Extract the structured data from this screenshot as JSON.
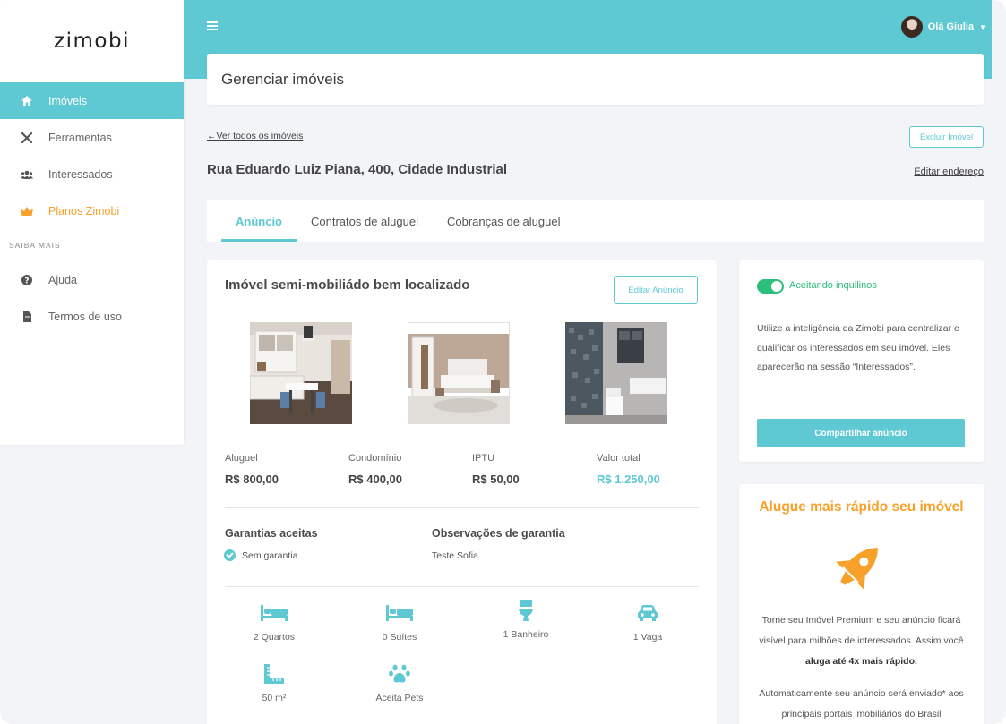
{
  "brand": "zimobi",
  "sidebar": {
    "items": [
      {
        "label": "Imóveis",
        "icon": "home-icon"
      },
      {
        "label": "Ferramentas",
        "icon": "tools-icon"
      },
      {
        "label": "Interessados",
        "icon": "users-icon"
      },
      {
        "label": "Planos Zimobi",
        "icon": "crown-icon"
      }
    ],
    "section_title": "SAIBA MAIS",
    "more_items": [
      {
        "label": "Ajuda",
        "icon": "help-icon"
      },
      {
        "label": "Termos de uso",
        "icon": "document-icon"
      }
    ]
  },
  "header": {
    "user_greeting": "Olá Giulia"
  },
  "page": {
    "title": "Gerenciar imóveis",
    "back_link": "Ver todos os imóveis",
    "delete_button": "Excluir Imóvel",
    "address": "Rua Eduardo Luiz Piana, 400, Cidade Industrial",
    "edit_address": "Editar endereço",
    "tabs": [
      "Anúncio",
      "Contratos de aluguel",
      "Cobranças de aluguel"
    ]
  },
  "listing": {
    "title": "Imóvel semi-mobiliádo bem localizado",
    "edit_button": "Editar Anúncio",
    "prices": [
      {
        "label": "Aluguel",
        "value": "R$ 800,00"
      },
      {
        "label": "Condomínio",
        "value": "R$ 400,00"
      },
      {
        "label": "IPTU",
        "value": "R$ 50,00"
      },
      {
        "label": "Valor total",
        "value": "R$ 1.250,00"
      }
    ],
    "guarantees_title": "Garantias aceitas",
    "guarantee": "Sem garantia",
    "guarantee_notes_title": "Observações de garantia",
    "guarantee_notes": "Teste Sofia",
    "features": [
      {
        "label": "2 Quartos",
        "icon": "bed-icon"
      },
      {
        "label": "0 Suítes",
        "icon": "bed-icon"
      },
      {
        "label": "1 Banheiro",
        "icon": "toilet-icon"
      },
      {
        "label": "1 Vaga",
        "icon": "car-icon"
      },
      {
        "label": "50 m²",
        "icon": "ruler-icon"
      },
      {
        "label": "Aceita Pets",
        "icon": "paw-icon"
      }
    ]
  },
  "share": {
    "toggle_label": "Aceitando inquilinos",
    "text": "Utilize a inteligência da Zimobi para centralizar e qualificar os interessados em seu imóvel. Eles aparecerão na sessão “Interessados”.",
    "button": "Compartilhar anúncio"
  },
  "promo": {
    "title": "Alugue mais rápido seu imóvel",
    "text_start": "Torne seu Imóvel Premium e seu anúncio ficará visível para milhões de interessados. Assim você",
    "text_bold": "aluga até 4x mais rápido.",
    "text2": "Automaticamente seu anúncio será enviado* aos principais portais imobiliários do Brasil"
  },
  "colors": {
    "accent": "#5ec8d3",
    "orange": "#f7a12a",
    "green": "#2cbf7c"
  }
}
